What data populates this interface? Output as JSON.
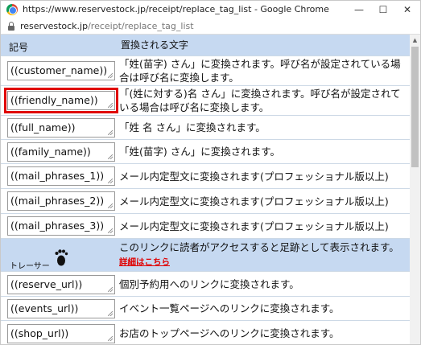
{
  "window": {
    "title": "https://www.reservestock.jp/receipt/replace_tag_list - Google Chrome",
    "url_host": "reservestock.jp",
    "url_path": "/receipt/replace_tag_list"
  },
  "table": {
    "header": {
      "tag": "記号",
      "desc": "置換される文字"
    },
    "rows": [
      {
        "tag": "((customer_name))",
        "desc": "「姓(苗字) さん」に変換されます。呼び名が設定されている場合は呼び名に変換します。"
      },
      {
        "tag": "((friendly_name))",
        "desc": "「(姓に対する)名 さん」に変換されます。呼び名が設定されている場合は呼び名に変換します。"
      },
      {
        "tag": "((full_name))",
        "desc": "「姓 名 さん」に変換されます。"
      },
      {
        "tag": "((family_name))",
        "desc": "「姓(苗字) さん」に変換されます。"
      },
      {
        "tag": "((mail_phrases_1))",
        "desc": "メール内定型文に変換されます(プロフェッショナル版以上)"
      },
      {
        "tag": "((mail_phrases_2))",
        "desc": "メール内定型文に変換されます(プロフェッショナル版以上)"
      },
      {
        "tag": "((mail_phrases_3))",
        "desc": "メール内定型文に変換されます(プロフェッショナル版以上)"
      },
      {
        "tag": "トレーサー",
        "desc": "このリンクに読者がアクセスすると足跡として表示されます。",
        "link": "詳細はこちら"
      },
      {
        "tag": "((reserve_url))",
        "desc": "個別予約用へのリンクに変換されます。"
      },
      {
        "tag": "((events_url))",
        "desc": "イベント一覧ページへのリンクに変換されます。"
      },
      {
        "tag": "((shop_url))",
        "desc": "お店のトップページへのリンクに変換されます。"
      }
    ]
  },
  "colors": {
    "header_bg": "#c6d9f1",
    "highlight": "#e00000",
    "link": "#e00000"
  }
}
